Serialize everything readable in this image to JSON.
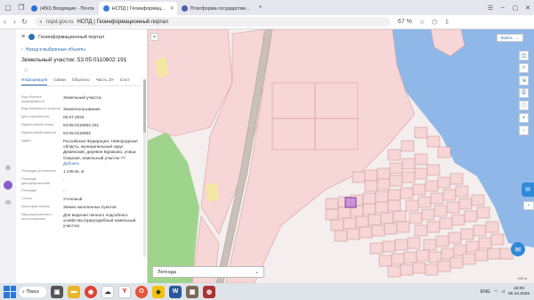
{
  "browser": {
    "tabs": [
      {
        "label": "(450) Входящие - Почта",
        "favicon_color": "#2b6de0",
        "active": false
      },
      {
        "label": "НСПД | Геоинформац...",
        "favicon_color": "#3a7bd5",
        "active": true
      },
      {
        "label": "Платформа государстве...",
        "favicon_color": "#4c5fa8",
        "active": false
      }
    ],
    "url_domain": "nspd.gov.ru",
    "url_title": "НСПД | Геоинформационный портал",
    "zoom": "67 %"
  },
  "panel": {
    "app_title": "Геоинформационный портал",
    "back_label": "Назад в выбранные объекты",
    "parcel_title": "Земельный участок: 53:05:0110802:191",
    "tabs": [
      "Информация",
      "Связи",
      "Объекты",
      "Часть ЗУ",
      "Сост"
    ],
    "properties": [
      {
        "label": "Вид объекта недвижимости",
        "value": "Земельный участок"
      },
      {
        "label": "Вид земельного участка",
        "value": "Землепользование"
      },
      {
        "label": "Дата присвоения",
        "value": "06.07.2022"
      },
      {
        "label": "Кадастровый номер",
        "value": "53:05:0110802:191"
      },
      {
        "label": "Кадастровый квартал",
        "value": "53:05:0110802"
      },
      {
        "label": "Адрес",
        "value": "Российская Федерация, Новгородская область, муниципальный округ Демянский, деревня Бураково, улица Озерная, земельный участок 77",
        "link": "Дублить"
      },
      {
        "label": "Площадь уточненная",
        "value": "1 238 кв. м"
      },
      {
        "label": "Площадь декларированная",
        "value": "-"
      },
      {
        "label": "Площадь",
        "value": "-"
      },
      {
        "label": "Статус",
        "value": "Учтенный"
      },
      {
        "label": "Категория земель",
        "value": "Земли населенных пунктов"
      },
      {
        "label": "Вид разрешенного использования",
        "value": "Для ведения личного подсобного хозяйства (приусадебный земельный участок)"
      }
    ]
  },
  "map": {
    "login_label": "Войти",
    "legend_label": "Легенда",
    "scale_label": "100 м",
    "colors": {
      "parcel_fill": "#f6d6d6",
      "parcel_stroke": "#d9a0a0",
      "forest": "#8fcf7a",
      "water": "#8fb8e8",
      "selected": "#b97ad6",
      "road": "#9a9a9a"
    }
  },
  "taskbar": {
    "search_label": "Поиск",
    "lang": "ENG",
    "time": "15:00",
    "date": "06.10.2025"
  }
}
